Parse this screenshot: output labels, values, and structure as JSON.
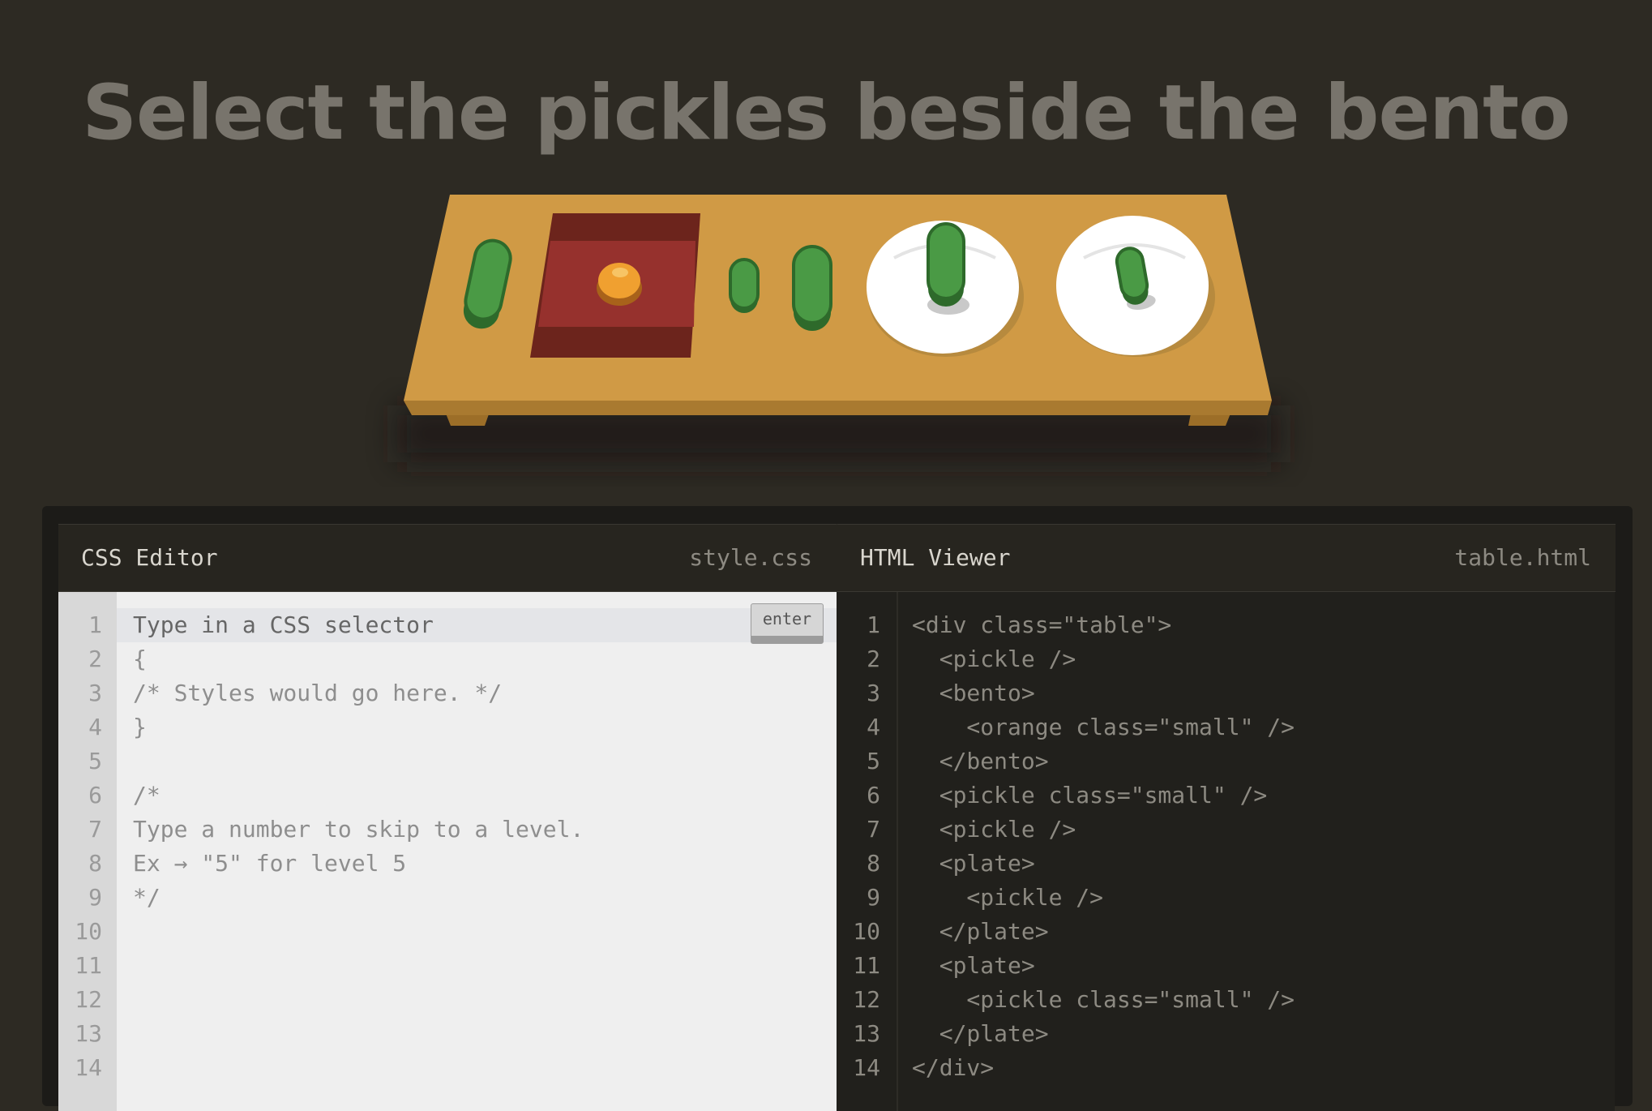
{
  "level_order": "Select the pickles beside the bento",
  "css_editor": {
    "title": "CSS Editor",
    "filename": "style.css",
    "enter_label": "enter",
    "line_numbers": [
      "1",
      "2",
      "3",
      "4",
      "5",
      "6",
      "7",
      "8",
      "9",
      "10",
      "11",
      "12",
      "13",
      "14"
    ],
    "lines": [
      "Type in a CSS selector",
      "{",
      "/* Styles would go here. */",
      "}",
      "",
      "/*",
      "Type a number to skip to a level.",
      "Ex → \"5\" for level 5",
      "*/",
      "",
      "",
      "",
      "",
      ""
    ]
  },
  "html_viewer": {
    "title": "HTML Viewer",
    "filename": "table.html",
    "line_numbers": [
      "1",
      "2",
      "3",
      "4",
      "5",
      "6",
      "7",
      "8",
      "9",
      "10",
      "11",
      "12",
      "13",
      "14"
    ],
    "lines": [
      "<div class=\"table\">",
      "  <pickle />",
      "  <bento>",
      "    <orange class=\"small\" />",
      "  </bento>",
      "  <pickle class=\"small\" />",
      "  <pickle />",
      "  <plate>",
      "    <pickle />",
      "  </plate>",
      "  <plate>",
      "    <pickle class=\"small\" />",
      "  </plate>",
      "</div>"
    ]
  },
  "colors": {
    "background": "#2d2a23",
    "table": "#d09a45",
    "pickle": "#4a9a45",
    "bento": "#96312d",
    "orange": "#f0a030",
    "plate": "#ffffff"
  }
}
